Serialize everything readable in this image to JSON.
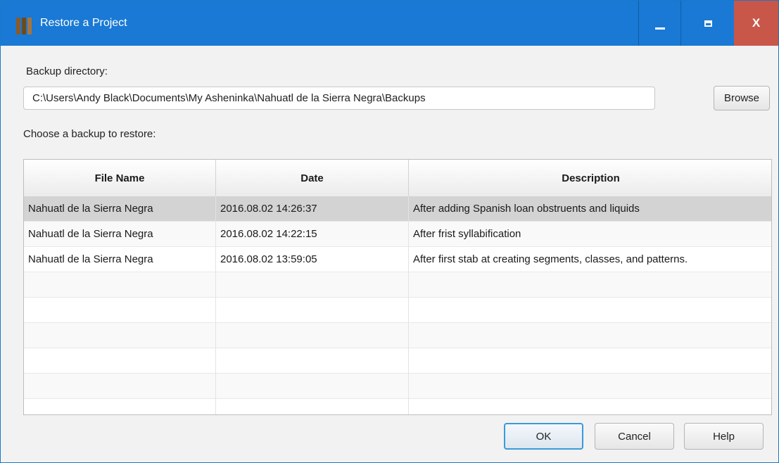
{
  "window": {
    "title": "Restore a Project",
    "icon": "books-icon",
    "controls": {
      "minimize": "minimize-icon",
      "maximize": "maximize-icon",
      "close_label": "X"
    }
  },
  "form": {
    "backup_dir_label": "Backup directory:",
    "backup_dir_value": "C:\\Users\\Andy Black\\Documents\\My Asheninka\\Nahuatl de la Sierra Negra\\Backups",
    "browse_label": "Browse",
    "choose_label": "Choose a backup to restore:"
  },
  "table": {
    "columns": [
      "File Name",
      "Date",
      "Description"
    ],
    "rows": [
      [
        "Nahuatl de la Sierra Negra",
        "2016.08.02 14:26:37",
        "After adding Spanish loan obstruents and liquids"
      ],
      [
        "Nahuatl de la Sierra Negra",
        "2016.08.02 14:22:15",
        "After frist syllabification"
      ],
      [
        "Nahuatl de la Sierra Negra",
        "2016.08.02 13:59:05",
        "After first stab at creating segments, classes, and patterns."
      ]
    ],
    "selected_row": 0
  },
  "buttons": {
    "ok": "OK",
    "cancel": "Cancel",
    "help": "Help"
  },
  "colors": {
    "titlebar": "#1979d4",
    "close": "#c8574a",
    "selection": "#d3d3d3",
    "default_button_border": "#3a9ad9"
  }
}
